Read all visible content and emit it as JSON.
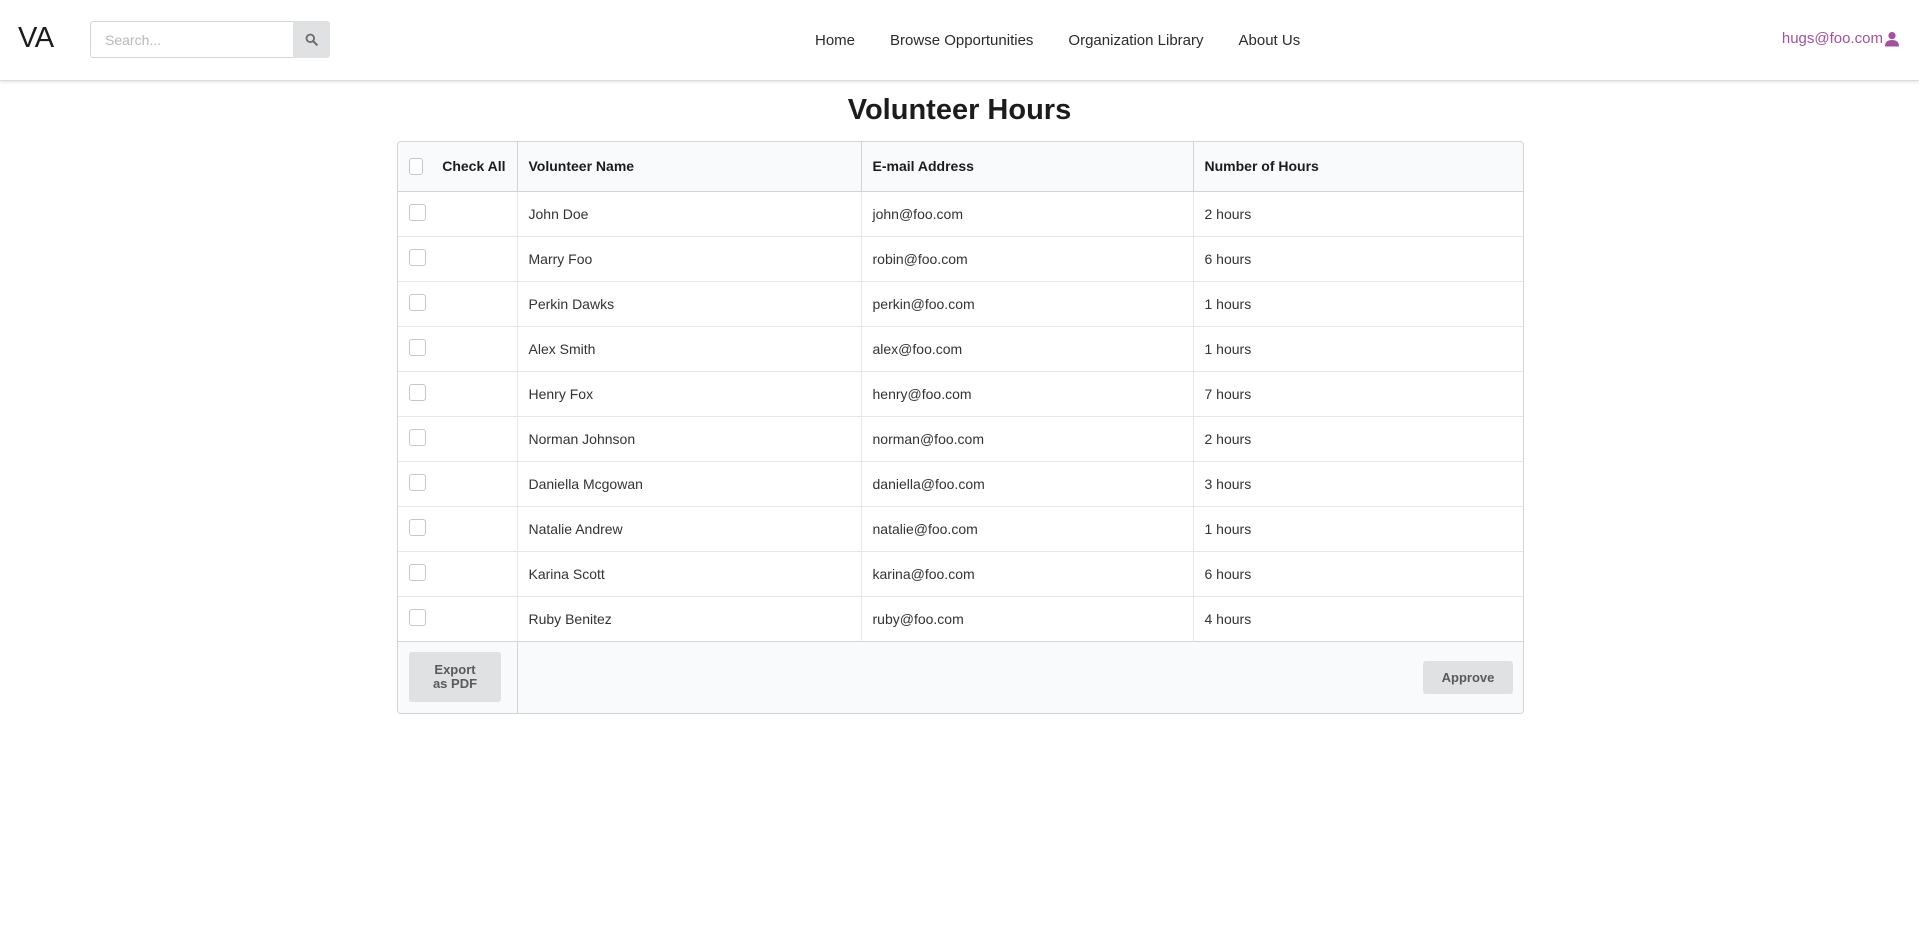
{
  "brand": "VA",
  "search": {
    "placeholder": "Search..."
  },
  "nav": [
    {
      "label": "Home"
    },
    {
      "label": "Browse Opportunities"
    },
    {
      "label": "Organization Library"
    },
    {
      "label": "About Us"
    }
  ],
  "user": {
    "email": "hugs@foo.com",
    "icon": "user-icon"
  },
  "page_title": "Volunteer Hours",
  "table": {
    "check_all_label": "Check All",
    "columns": [
      "Volunteer Name",
      "E-mail Address",
      "Number of Hours"
    ],
    "rows": [
      {
        "name": "John Doe",
        "email": "john@foo.com",
        "hours": "2 hours"
      },
      {
        "name": "Marry Foo",
        "email": "robin@foo.com",
        "hours": "6 hours"
      },
      {
        "name": "Perkin Dawks",
        "email": "perkin@foo.com",
        "hours": "1 hours"
      },
      {
        "name": "Alex Smith",
        "email": "alex@foo.com",
        "hours": "1 hours"
      },
      {
        "name": "Henry Fox",
        "email": "henry@foo.com",
        "hours": "7 hours"
      },
      {
        "name": "Norman Johnson",
        "email": "norman@foo.com",
        "hours": "2 hours"
      },
      {
        "name": "Daniella Mcgowan",
        "email": "daniella@foo.com",
        "hours": "3 hours"
      },
      {
        "name": "Natalie Andrew",
        "email": "natalie@foo.com",
        "hours": "1 hours"
      },
      {
        "name": "Karina Scott",
        "email": "karina@foo.com",
        "hours": "6 hours"
      },
      {
        "name": "Ruby Benitez",
        "email": "ruby@foo.com",
        "hours": "4 hours"
      }
    ]
  },
  "buttons": {
    "export_line1": "Export",
    "export_line2": "as PDF",
    "approve": "Approve"
  },
  "colors": {
    "accent": "#a34fa3",
    "button_bg": "#e0e1e2",
    "header_bg": "#f9fafb"
  }
}
